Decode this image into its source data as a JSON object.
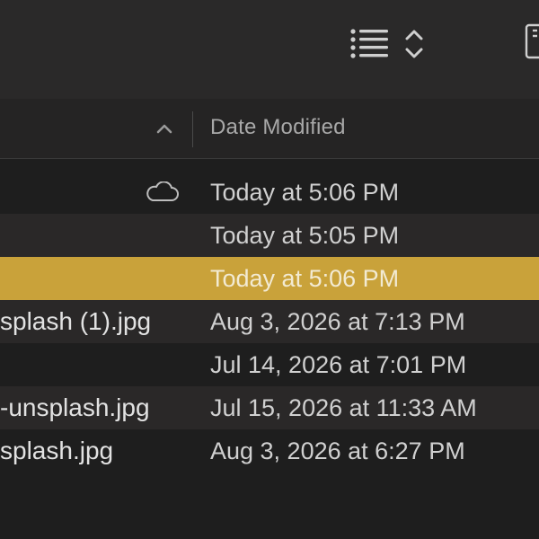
{
  "toolbar": {
    "icons": [
      "list-view-icon",
      "sort-icon",
      "panel-icon"
    ]
  },
  "header": {
    "sort_indicator": "chevron-up-icon",
    "column_label": "Date Modified"
  },
  "rows": [
    {
      "name": "",
      "date": "Today at 5:06 PM",
      "icon": "cloud-icon"
    },
    {
      "name": "",
      "date": "Today at 5:05 PM"
    },
    {
      "name": "",
      "date": "Today at 5:06 PM",
      "selected": true
    },
    {
      "name": "splash (1).jpg",
      "date": "Aug 3, 2026 at 7:13 PM"
    },
    {
      "name": "",
      "date": "Jul 14, 2026 at 7:01 PM"
    },
    {
      "name": "-unsplash.jpg",
      "date": "Jul 15, 2026 at 11:33 AM"
    },
    {
      "name": "splash.jpg",
      "date": "Aug 3, 2026 at 6:27 PM"
    }
  ],
  "colors": {
    "selection": "#c9a23a",
    "background": "#1e1e1e",
    "row_alt": "#2a2828"
  }
}
